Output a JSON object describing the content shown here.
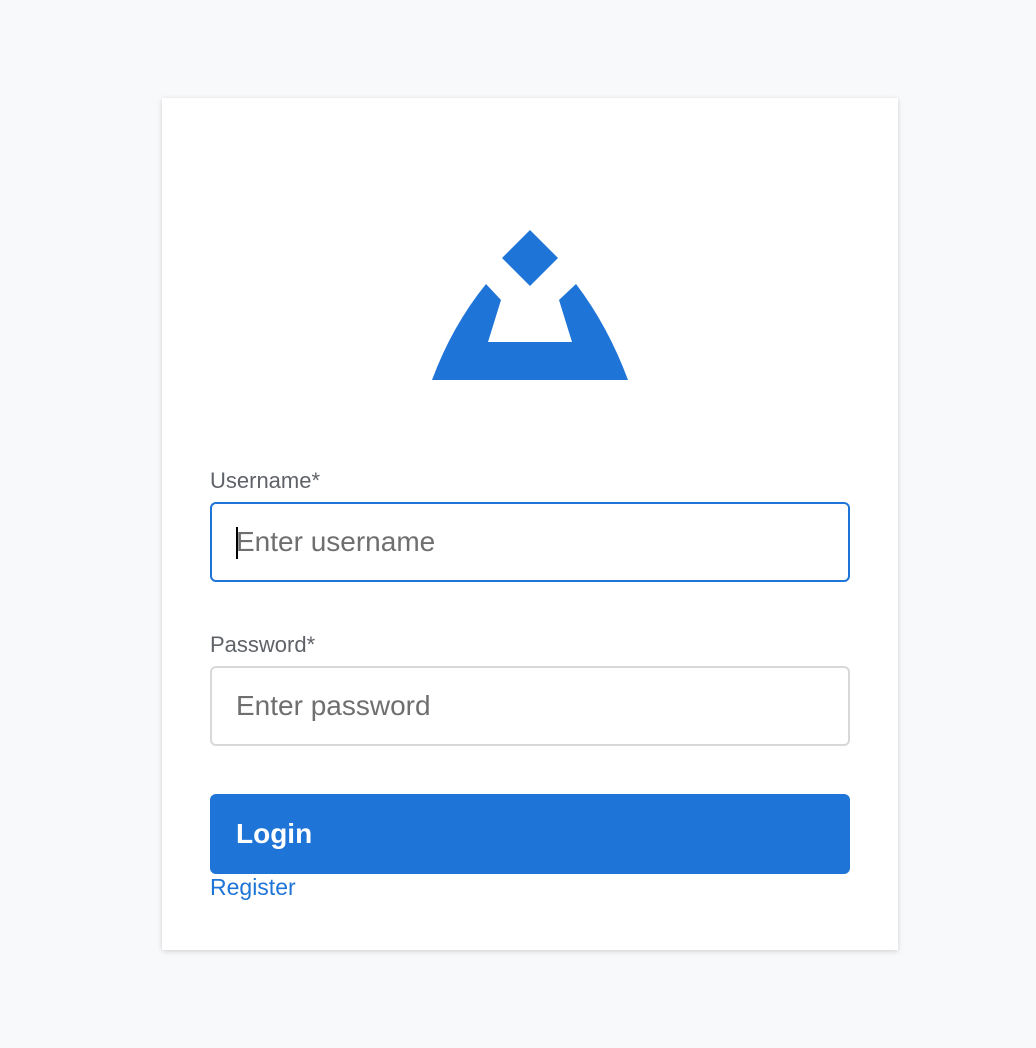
{
  "brand": {
    "logo_icon": "triangle-diamond-logo-icon",
    "accent_color": "#1e74d7"
  },
  "form": {
    "username": {
      "label": "Username*",
      "placeholder": "Enter username",
      "value": ""
    },
    "password": {
      "label": "Password*",
      "placeholder": "Enter password",
      "value": ""
    },
    "login_label": "Login",
    "register_label": "Register"
  }
}
